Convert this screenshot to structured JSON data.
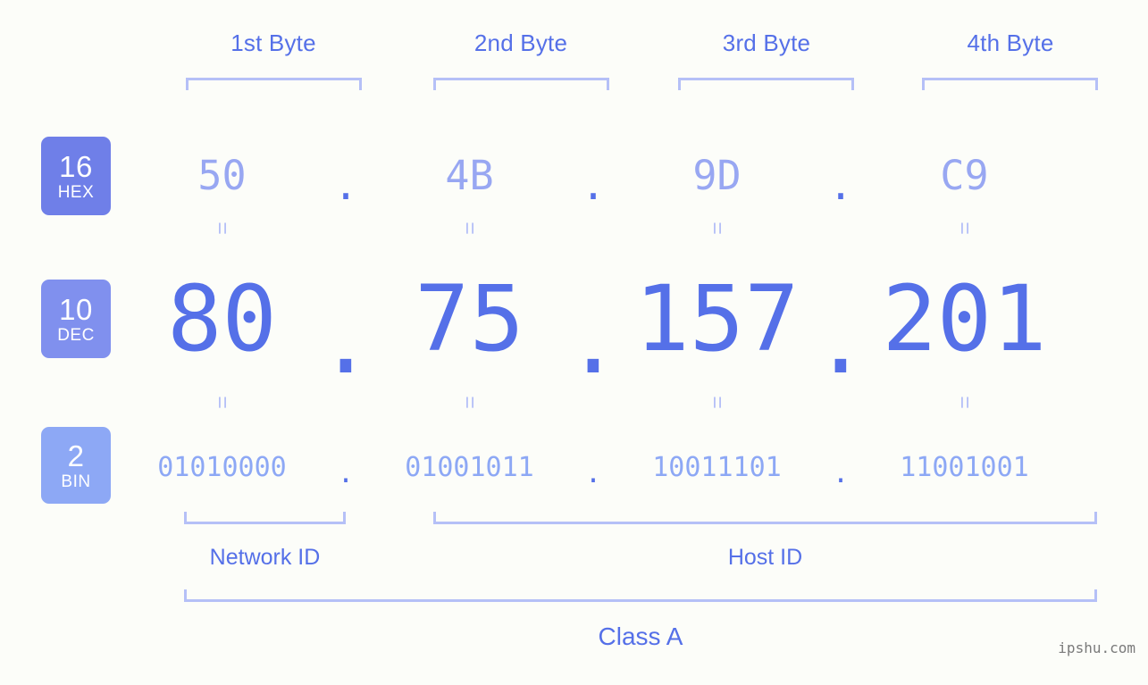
{
  "meta": {
    "background_color": "#fcfdf9",
    "accent_color": "#5570e8",
    "light_accent_color": "#b5c0f7"
  },
  "header": {
    "byte_labels": [
      "1st Byte",
      "2nd Byte",
      "3rd Byte",
      "4th Byte"
    ]
  },
  "bases": [
    {
      "number": "16",
      "name": "HEX",
      "color": "#6f7fe8"
    },
    {
      "number": "10",
      "name": "DEC",
      "color": "#8090ee"
    },
    {
      "number": "2",
      "name": "BIN",
      "color": "#8da8f5"
    }
  ],
  "rows": {
    "hex": {
      "octets": [
        "50",
        "4B",
        "9D",
        "C9"
      ],
      "separator": "."
    },
    "dec": {
      "octets": [
        "80",
        "75",
        "157",
        "201"
      ],
      "separator": "."
    },
    "bin": {
      "octets": [
        "01010000",
        "01001011",
        "10011101",
        "11001001"
      ],
      "separator": "."
    }
  },
  "equality_symbol": "=",
  "sections": {
    "network_id": "Network ID",
    "host_id": "Host ID",
    "class": "Class A"
  },
  "watermark": "ipshu.com"
}
